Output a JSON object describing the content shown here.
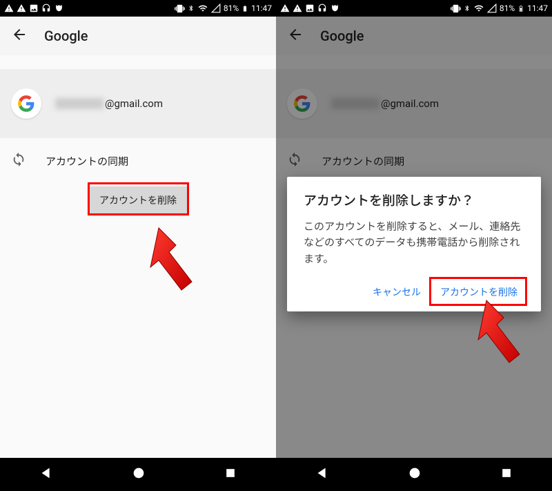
{
  "statusbar": {
    "battery_pct": "81%",
    "time": "11:47"
  },
  "appbar": {
    "title": "Google"
  },
  "account": {
    "email_suffix": "@gmail.com"
  },
  "sync": {
    "label": "アカウントの同期"
  },
  "delete_button": {
    "label": "アカウントを削除"
  },
  "dialog": {
    "title": "アカウントを削除しますか？",
    "body": "このアカウントを削除すると、メール、連絡先などのすべてのデータも携帯電話から削除されます。",
    "cancel": "キャンセル",
    "confirm": "アカウントを削除"
  }
}
